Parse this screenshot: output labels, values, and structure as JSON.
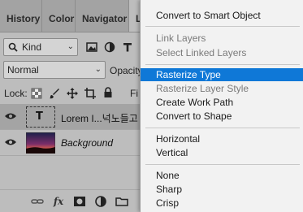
{
  "panel": {
    "tabs": [
      "History",
      "Color",
      "Navigator",
      "L"
    ],
    "filter": {
      "kind": "Kind"
    },
    "blend": {
      "mode": "Normal",
      "opacity_label": "Opacity"
    },
    "lock": {
      "label": "Lock:",
      "fill_label": "Fi"
    },
    "layers": [
      {
        "name": "Lorem I...넉노들고",
        "type": "text",
        "selected": true,
        "thumb_glyph": "T"
      },
      {
        "name": "Background",
        "type": "image",
        "selected": false
      }
    ],
    "bottom_icons": [
      "link-icon",
      "fx-icon",
      "mask-icon",
      "adjustment-icon",
      "folder-icon"
    ],
    "fx_label": "fx"
  },
  "menu": {
    "groups": [
      [
        {
          "label": "Convert to Smart Object",
          "enabled": true
        }
      ],
      [
        {
          "label": "Link Layers",
          "enabled": false
        },
        {
          "label": "Select Linked Layers",
          "enabled": false
        }
      ],
      [
        {
          "label": "Rasterize Type",
          "enabled": true,
          "highlighted": true
        },
        {
          "label": "Rasterize Layer Style",
          "enabled": false
        },
        {
          "label": "Create Work Path",
          "enabled": true
        },
        {
          "label": "Convert to Shape",
          "enabled": true
        }
      ],
      [
        {
          "label": "Horizontal",
          "enabled": true
        },
        {
          "label": "Vertical",
          "enabled": true
        }
      ],
      [
        {
          "label": "None",
          "enabled": true
        },
        {
          "label": "Sharp",
          "enabled": true
        },
        {
          "label": "Crisp",
          "enabled": true
        }
      ]
    ]
  },
  "colors": {
    "highlight": "#0f78d7",
    "panel_bg": "#bdbdbd",
    "menu_bg": "#f2f2f2"
  }
}
